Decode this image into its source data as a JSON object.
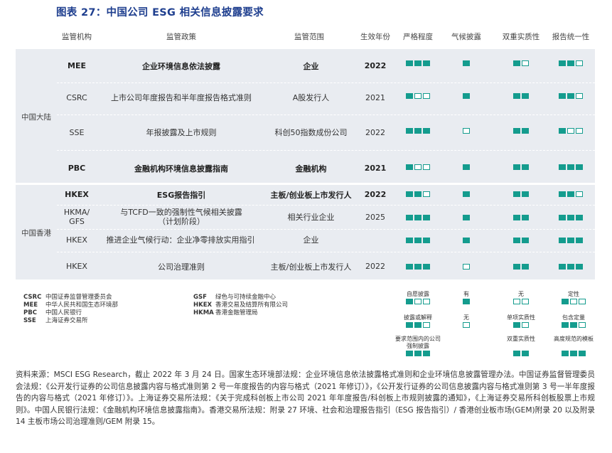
{
  "title": "图表 27：中国公司 ESG 相关信息披露要求",
  "colors": {
    "accent": "#149c8e",
    "title": "#1f3f8f",
    "panel": "#e9ecf1"
  },
  "headers": [
    "监管机构",
    "监管政策",
    "监管范围",
    "生效年份",
    "严格程度",
    "气候披露",
    "双重实质性",
    "报告统一性"
  ],
  "regions": [
    "中国大陆",
    "中国香港"
  ],
  "rows": [
    {
      "agency": "MEE",
      "policy": "企业环境信息依法披露",
      "scope": "企业",
      "year": "2022",
      "bold": true,
      "strictness": [
        1,
        1,
        1
      ],
      "climate": [
        1
      ],
      "materiality": [
        1,
        0
      ],
      "uniformity": [
        1,
        1,
        0
      ]
    },
    {
      "agency": "CSRC",
      "policy": "上市公司年度报告和半年度报告格式准则",
      "scope": "A股发行人",
      "year": "2021",
      "bold": false,
      "strictness": [
        1,
        0,
        0
      ],
      "climate": [
        1
      ],
      "materiality": [
        1,
        1
      ],
      "uniformity": [
        1,
        1,
        0
      ]
    },
    {
      "agency": "SSE",
      "policy": "年报披露及上市规则",
      "scope": "科创50指数成份公司",
      "year": "2022",
      "bold": false,
      "strictness": [
        1,
        1,
        1
      ],
      "climate": [
        0
      ],
      "materiality": [
        1,
        1
      ],
      "uniformity": [
        1,
        0,
        0
      ]
    },
    {
      "agency": "PBC",
      "policy": "金融机构环境信息披露指南",
      "scope": "金融机构",
      "year": "2021",
      "bold": true,
      "strictness": [
        1,
        0,
        0
      ],
      "climate": [
        1
      ],
      "materiality": [
        1,
        1
      ],
      "uniformity": [
        1,
        1,
        1
      ]
    },
    {
      "agency": "HKEX",
      "policy": "ESG报告指引",
      "scope": "主板/创业板上市发行人",
      "year": "2022",
      "bold": true,
      "strictness": [
        1,
        1,
        0
      ],
      "climate": [
        1
      ],
      "materiality": [
        1,
        1
      ],
      "uniformity": [
        1,
        1,
        0
      ]
    },
    {
      "agency": "HKMA/\nGFS",
      "policy": "与TCFD一致的强制性气候相关披露\n（计划阶段）",
      "scope": "相关行业企业",
      "year": "2025",
      "bold": false,
      "strictness": [
        1,
        1,
        1
      ],
      "climate": [
        1
      ],
      "materiality": [
        1,
        1
      ],
      "uniformity": [
        1,
        1,
        1
      ]
    },
    {
      "agency": "HKEX",
      "policy": "推进企业气候行动：企业净零排放实用指引",
      "scope": "企业",
      "year": "",
      "bold": false,
      "strictness": [
        1,
        1,
        1
      ],
      "climate": [
        1
      ],
      "materiality": [
        1,
        1
      ],
      "uniformity": [
        1,
        1,
        1
      ]
    },
    {
      "agency": "HKEX",
      "policy": "公司治理准则",
      "scope": "主板/创业板上市发行人",
      "year": "2022",
      "bold": false,
      "strictness": [
        1,
        1,
        1
      ],
      "climate": [
        0
      ],
      "materiality": [
        1,
        1
      ],
      "uniformity": [
        1,
        1,
        1
      ]
    }
  ],
  "abbreviations_left": [
    {
      "abbr": "CSRC",
      "full": "中国证券监督管理委员会"
    },
    {
      "abbr": "MEE",
      "full": "中华人民共和国生态环境部"
    },
    {
      "abbr": "PBC",
      "full": "中国人民银行"
    },
    {
      "abbr": "SSE",
      "full": "上海证券交易所"
    }
  ],
  "abbreviations_right": [
    {
      "abbr": "GSF",
      "full": "绿色与可持续金融中心"
    },
    {
      "abbr": "HKEX",
      "full": "香港交易及结算所有限公司"
    },
    {
      "abbr": "HKMA",
      "full": "香港金融管理局"
    }
  ],
  "legend": {
    "strictness": [
      {
        "label": "自愿披露",
        "icon": [
          1,
          0,
          0
        ]
      },
      {
        "label": "披露或解释",
        "icon": [
          1,
          1,
          0
        ]
      },
      {
        "label": "要求范围内的公司强制披露",
        "icon": [
          1,
          1,
          1
        ]
      }
    ],
    "climate": [
      {
        "label": "有",
        "icon": [
          1
        ]
      },
      {
        "label": "无",
        "icon": [
          0
        ]
      }
    ],
    "materiality": [
      {
        "label": "无",
        "icon": [
          0,
          0
        ]
      },
      {
        "label": "单项实质性",
        "icon": [
          1,
          0
        ]
      },
      {
        "label": "双重实质性",
        "icon": [
          1,
          1
        ]
      }
    ],
    "uniformity": [
      {
        "label": "定性",
        "icon": [
          1,
          0,
          0
        ]
      },
      {
        "label": "包含定量",
        "icon": [
          1,
          1,
          0
        ]
      },
      {
        "label": "高度规范的模板",
        "icon": [
          1,
          1,
          1
        ]
      }
    ]
  },
  "source": "资料来源：MSCI ESG Research，截止 2022 年 3 月 24 日。国家生态环境部法规：企业环境信息依法披露格式准则和企业环境信息披露管理办法。中国证券监督管理委员会法规：《公开发行证券的公司信息披露内容与格式准则第 2 号一年度报告的内容与格式（2021 年修订）》，《公开发行证券的公司信息披露内容与格式准则第 3 号一半年度报告的内容与格式（2021 年修订）》。上海证券交易所法规：《关于完成科创板上市公司 2021 年年度报告/科创板上市规则披露的通知》，《上海证券交易所科创板股票上市规则》。中国人民银行法规：《金融机构环境信息披露指南》。香港交易所法规：附录 27 环境、社会和治理报告指引（ESG 报告指引）/ 香港创业板市场(GEM)附录 20 以及附录 14 主板市场公司治理准则/GEM 附录 15。"
}
